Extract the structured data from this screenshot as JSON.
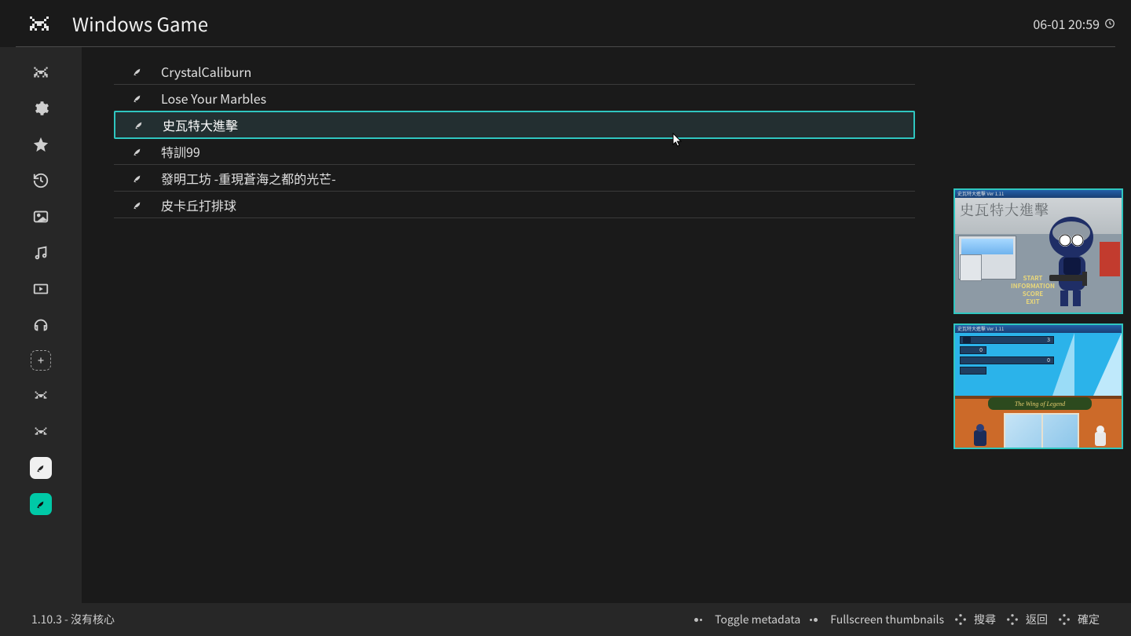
{
  "header": {
    "title": "Windows Game",
    "clock": "06-01 20:59"
  },
  "sidebar_icons": [
    "invader",
    "gear",
    "star",
    "history",
    "image",
    "music",
    "video",
    "headphones",
    "add",
    "invader2",
    "invader3"
  ],
  "games": [
    {
      "label": "CrystalCaliburn",
      "selected": false
    },
    {
      "label": "Lose Your Marbles",
      "selected": false
    },
    {
      "label": "史瓦特大進擊",
      "selected": true
    },
    {
      "label": "特訓99",
      "selected": false
    },
    {
      "label": "發明工坊 -重現蒼海之都的光芒-",
      "selected": false
    },
    {
      "label": "皮卡丘打排球",
      "selected": false
    }
  ],
  "preview": {
    "titlebar": "史瓦特大進擊 Ver 1.11",
    "title_overlay": "史瓦特大進擊",
    "menu_items": [
      "START",
      "INFORMATION",
      "SCORE",
      "EXIT"
    ],
    "hud": {
      "bar1": "3",
      "bar2": "0",
      "bar3": "0"
    },
    "sign": "The Wing of Legend"
  },
  "footer": {
    "version": "1.10.3 - 沒有核心",
    "hints": [
      {
        "label": "Toggle metadata"
      },
      {
        "label": "Fullscreen thumbnails"
      },
      {
        "label": "搜尋"
      },
      {
        "label": "返回"
      },
      {
        "label": "確定"
      }
    ]
  }
}
